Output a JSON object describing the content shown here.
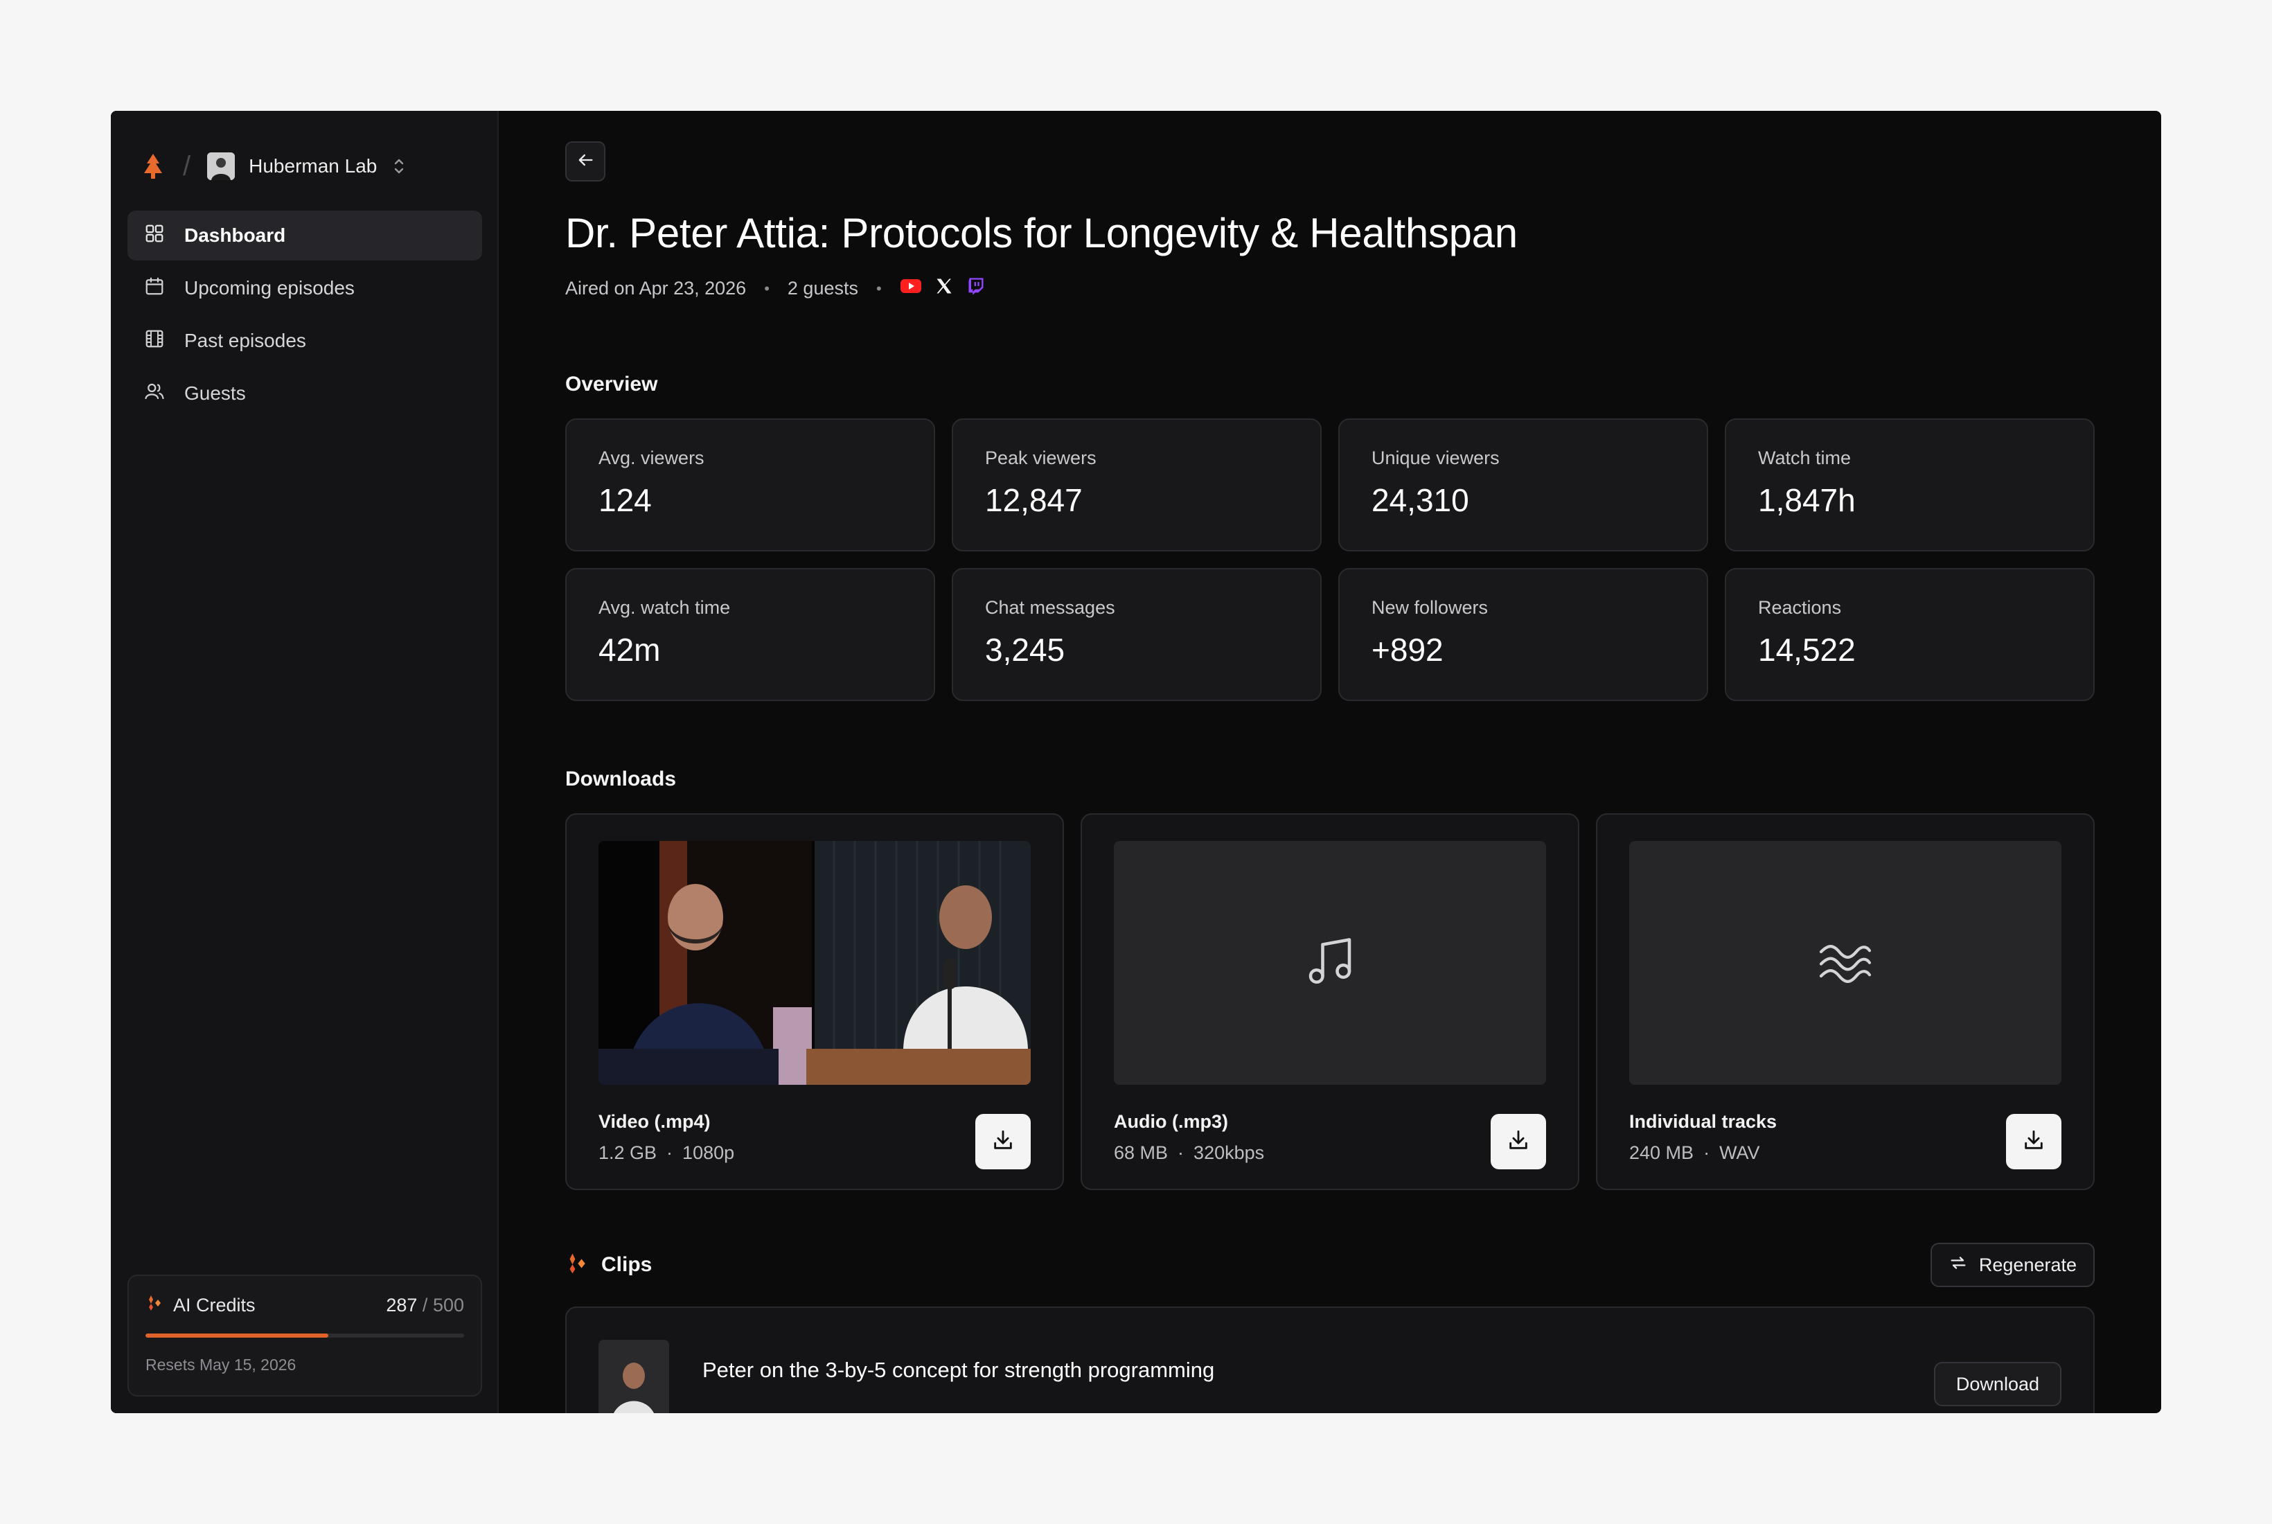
{
  "workspace": {
    "name": "Huberman Lab"
  },
  "nav": [
    {
      "label": "Dashboard",
      "icon": "grid-icon",
      "active": true
    },
    {
      "label": "Upcoming episodes",
      "icon": "calendar-icon"
    },
    {
      "label": "Past episodes",
      "icon": "film-icon"
    },
    {
      "label": "Guests",
      "icon": "users-icon"
    }
  ],
  "credits": {
    "label": "AI Credits",
    "used": "287",
    "separator": "/",
    "total": "500",
    "fraction": 0.574,
    "reset": "Resets May 15, 2026",
    "accent": "#e0622b"
  },
  "episode": {
    "title": "Dr. Peter Attia: Protocols for Longevity & Healthspan",
    "aired": "Aired on Apr 23, 2026",
    "guests": "2 guests",
    "socials": [
      "youtube-icon",
      "x-icon",
      "twitch-icon"
    ]
  },
  "overview": {
    "title": "Overview",
    "stats": [
      {
        "label": "Avg. viewers",
        "value": "124"
      },
      {
        "label": "Peak viewers",
        "value": "12,847"
      },
      {
        "label": "Unique viewers",
        "value": "24,310"
      },
      {
        "label": "Watch time",
        "value": "1,847h"
      },
      {
        "label": "Avg. watch time",
        "value": "42m"
      },
      {
        "label": "Chat messages",
        "value": "3,245"
      },
      {
        "label": "New followers",
        "value": "+892"
      },
      {
        "label": "Reactions",
        "value": "14,522"
      }
    ]
  },
  "downloads": {
    "title": "Downloads",
    "items": [
      {
        "name": "Video (.mp4)",
        "size": "1.2 GB",
        "detail": "1080p",
        "thumb": "video-thumbnail"
      },
      {
        "name": "Audio (.mp3)",
        "size": "68 MB",
        "detail": "320kbps",
        "thumb": "music-note-icon"
      },
      {
        "name": "Individual tracks",
        "size": "240 MB",
        "detail": "WAV",
        "thumb": "waves-icon"
      }
    ]
  },
  "clips": {
    "title": "Clips",
    "regenerate": "Regenerate",
    "items": [
      {
        "title": "Peter on the 3-by-5 concept for strength programming",
        "action": "Download"
      }
    ]
  }
}
